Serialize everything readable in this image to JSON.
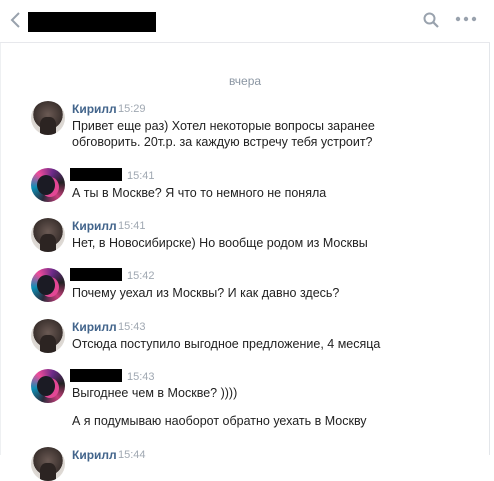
{
  "header": {
    "back_icon": "chevron-left-icon",
    "search_icon": "search-icon",
    "more_icon": "more-dots-icon"
  },
  "date_separator": "вчера",
  "messages": [
    {
      "author": "Кирилл",
      "time": "15:29",
      "lines": [
        "Привет еще раз) Хотел некоторые вопросы заранее",
        "обговорить. 20т.р. за каждую встречу тебя устроит?"
      ]
    },
    {
      "author": "",
      "time": "15:41",
      "lines": [
        "А ты в Москве? Я что то немного не поняла"
      ]
    },
    {
      "author": "Кирилл",
      "time": "15:41",
      "lines": [
        "Нет, в Новосибирске) Но вообще родом из Москвы"
      ]
    },
    {
      "author": "",
      "time": "15:42",
      "lines": [
        "Почему уехал из Москвы? И как давно здесь?"
      ]
    },
    {
      "author": "Кирилл",
      "time": "15:43",
      "lines": [
        "Отсюда поступило выгодное предложение, 4 месяца"
      ]
    },
    {
      "author": "",
      "time": "15:43",
      "lines": [
        "Выгоднее чем в Москве? ))))",
        "А я подумываю наоборот обратно уехать в Москву"
      ]
    },
    {
      "author": "Кирилл",
      "time": "15:44",
      "lines": []
    }
  ],
  "colors": {
    "author": "#42648b",
    "meta": "#a0a8b2",
    "divider": "#e7e8ec"
  }
}
